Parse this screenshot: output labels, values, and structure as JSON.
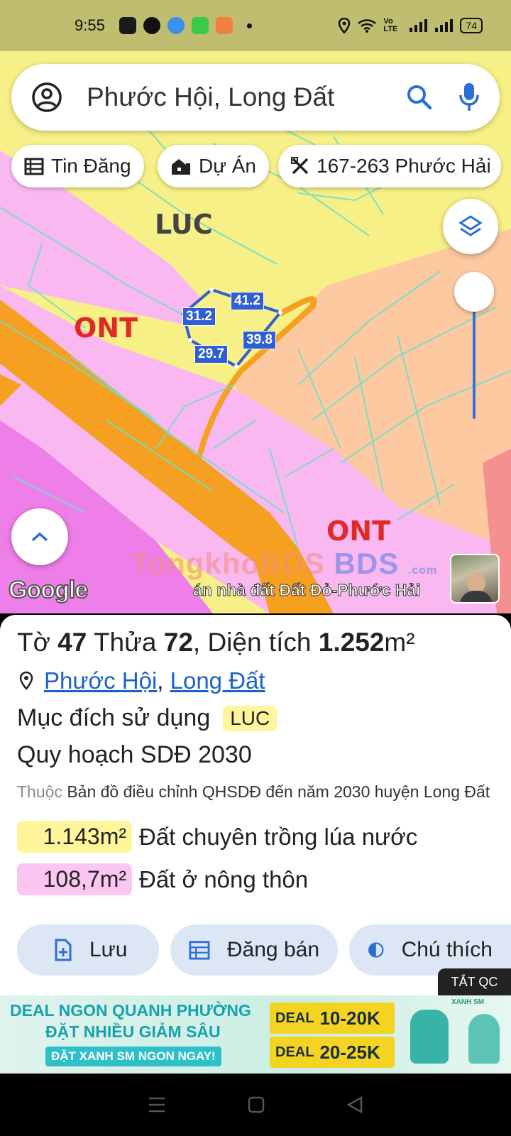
{
  "status_bar": {
    "time": "9:55",
    "battery": "74",
    "network": "Vo LTE"
  },
  "search": {
    "text": "Phước Hội, Long Đất"
  },
  "chips": [
    {
      "label": "Tin Đăng",
      "icon": "calendar-icon"
    },
    {
      "label": "Dự Án",
      "icon": "building-icon"
    },
    {
      "label": "167-263 Phước Hải",
      "icon": "ruler-icon"
    }
  ],
  "map": {
    "zones": {
      "luc": "LUC",
      "ont_left": "ONT",
      "ont_right": "ONT"
    },
    "dimensions": {
      "top": "41.2",
      "left": "31.2",
      "right": "39.8",
      "bottom": "29.7"
    },
    "watermark_left": "TongkhoBDS",
    "watermark_right": "BDS",
    "watermark_sub": ".com",
    "google": "Google",
    "caption": "án nhà đất Đất Đỏ-Phước Hải",
    "colors": {
      "luc": "#f7f086",
      "ont": "#f9b8f0",
      "road": "#f5a020",
      "orange_zone": "#fcc9a0",
      "parcel_border": "#2f5fd0"
    }
  },
  "parcel": {
    "sheet_label": "Tờ",
    "sheet_no": "47",
    "lot_label": "Thửa",
    "lot_no": "72",
    "area_label": ", Diện tích",
    "area": "1.252",
    "area_unit": "m²",
    "ward": "Phước Hội",
    "district": "Long Đất",
    "purpose_label": "Mục đích sử dụng",
    "purpose_code": "LUC",
    "plan": "Quy hoạch SDĐ 2030",
    "note_prefix": "Thuộc",
    "note": "Bản đồ điều chỉnh QHSDĐ đến năm 2030 huyện Long Đất",
    "breakdown": [
      {
        "value": "1.143m²",
        "label": "Đất chuyên trồng lúa nước",
        "color": "#fff59a"
      },
      {
        "value": "108,7m²",
        "label": "Đất ở nông thôn",
        "color": "#fbc6f2"
      }
    ]
  },
  "actions": {
    "save": "Lưu",
    "post": "Đăng bán",
    "legend": "Chú thích"
  },
  "ad": {
    "close": "TẮT QC",
    "line1": "DEAL NGON QUANH PHƯỜNG",
    "line2": "ĐẶT NHIỀU GIẢM SÂU",
    "cta": "ĐẶT XANH SM NGON NGAY!",
    "deal1_word": "DEAL",
    "deal1_value": "10-20K",
    "deal2_word": "DEAL",
    "deal2_value": "20-25K",
    "brand": "XANH SM"
  }
}
